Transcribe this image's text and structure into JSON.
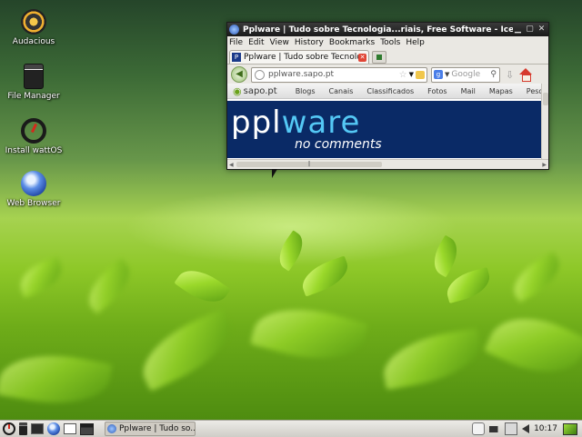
{
  "desktop": {
    "icons": [
      {
        "label": "Audacious",
        "icon": "audacious-icon"
      },
      {
        "label": "File Manager",
        "icon": "file-manager-icon"
      },
      {
        "label": "Install wattOS",
        "icon": "install-icon"
      },
      {
        "label": "Web Browser",
        "icon": "web-browser-icon"
      }
    ]
  },
  "window": {
    "title": "Pplware | Tudo sobre Tecnologia...riais, Free Software - Iceweasel",
    "menu": [
      "File",
      "Edit",
      "View",
      "History",
      "Bookmarks",
      "Tools",
      "Help"
    ],
    "tab_label": "Pplware | Tudo sobre Tecnologia...",
    "url": "pplware.sapo.pt",
    "search_placeholder": "Google",
    "site_nav": {
      "logo": "sapo.pt",
      "links": [
        "Blogs",
        "Canais",
        "Classificados",
        "Fotos",
        "Mail",
        "Mapas",
        "Pesquisa"
      ]
    },
    "banner": {
      "brand_a": "ppl",
      "brand_b": "ware",
      "tagline": "no comments",
      "background": "#0a2a66",
      "accent": "#54c8f5"
    },
    "hscroll_grip": "‖"
  },
  "taskbar": {
    "task_label": "Pplware | Tudo so...",
    "clock": "10:17"
  }
}
